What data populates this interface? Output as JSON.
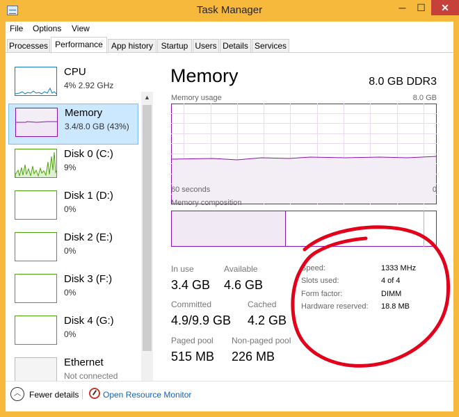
{
  "window": {
    "title": "Task Manager",
    "minimize_glyph": "─",
    "maximize_glyph": "☐",
    "close_glyph": "✕"
  },
  "menu": [
    "File",
    "Options",
    "View"
  ],
  "tabs": [
    {
      "label": "Processes"
    },
    {
      "label": "Performance",
      "active": true
    },
    {
      "label": "App history"
    },
    {
      "label": "Startup"
    },
    {
      "label": "Users"
    },
    {
      "label": "Details"
    },
    {
      "label": "Services"
    }
  ],
  "resources": [
    {
      "title": "CPU",
      "sub": "4% 2.92 GHz"
    },
    {
      "title": "Memory",
      "sub": "3.4/8.0 GB (43%)",
      "selected": true
    },
    {
      "title": "Disk 0 (C:)",
      "sub": "9%"
    },
    {
      "title": "Disk 1 (D:)",
      "sub": "0%"
    },
    {
      "title": "Disk 2 (E:)",
      "sub": "0%"
    },
    {
      "title": "Disk 3 (F:)",
      "sub": "0%"
    },
    {
      "title": "Disk 4 (G:)",
      "sub": "0%"
    },
    {
      "title": "Ethernet",
      "sub": "Not connected"
    }
  ],
  "scroll": {
    "up_glyph": "▲",
    "down_glyph": "▼"
  },
  "memory": {
    "title": "Memory",
    "spec": "8.0 GB DDR3",
    "usage_label": "Memory usage",
    "usage_max": "8.0 GB",
    "time_span": "60 seconds",
    "time_end": "0",
    "composition_label": "Memory composition",
    "usage_fraction": 0.43,
    "stats": {
      "in_use_label": "In use",
      "in_use": "3.4 GB",
      "available_label": "Available",
      "available": "4.6 GB",
      "committed_label": "Committed",
      "committed": "4.9/9.9 GB",
      "cached_label": "Cached",
      "cached": "4.2 GB",
      "paged_label": "Paged pool",
      "paged": "515 MB",
      "nonpaged_label": "Non-paged pool",
      "nonpaged": "226 MB"
    },
    "specs": [
      {
        "label": "Speed:",
        "value": "1333 MHz"
      },
      {
        "label": "Slots used:",
        "value": "4 of 4"
      },
      {
        "label": "Form factor:",
        "value": "DIMM"
      },
      {
        "label": "Hardware reserved:",
        "value": "18.8 MB"
      }
    ]
  },
  "footer": {
    "fewer_details": "Fewer details",
    "fewer_glyph": "︿",
    "open_resource_monitor": "Open Resource Monitor"
  },
  "colors": {
    "frame": "#f6b93b",
    "cpu": "#117dbb",
    "memory": "#8b12ae",
    "disk": "#4da60c",
    "ethernet": "#a74f01",
    "annotation": "#e3001b",
    "selected": "#cce8ff"
  }
}
